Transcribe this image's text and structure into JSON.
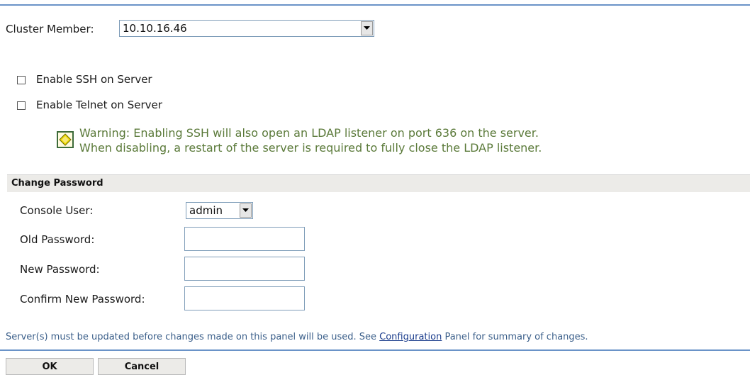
{
  "cluster": {
    "label": "Cluster Member:",
    "value": "10.10.16.46"
  },
  "options": {
    "ssh_label": "Enable SSH on Server",
    "telnet_label": "Enable Telnet on Server"
  },
  "warning": {
    "line1": "Warning: Enabling SSH will also open an LDAP listener on port 636 on the server.",
    "line2": "When disabling, a restart of the server is required to fully close the LDAP listener."
  },
  "password_section": {
    "title": "Change Password",
    "console_user_label": "Console User:",
    "console_user_value": "admin",
    "old_password_label": "Old Password:",
    "new_password_label": "New Password:",
    "confirm_password_label": "Confirm New Password:"
  },
  "footer": {
    "note_before": "Server(s) must be updated before changes made on this panel will be used. See ",
    "note_link": "Configuration",
    "note_after": " Panel for summary of changes."
  },
  "buttons": {
    "ok": "OK",
    "cancel": "Cancel"
  }
}
